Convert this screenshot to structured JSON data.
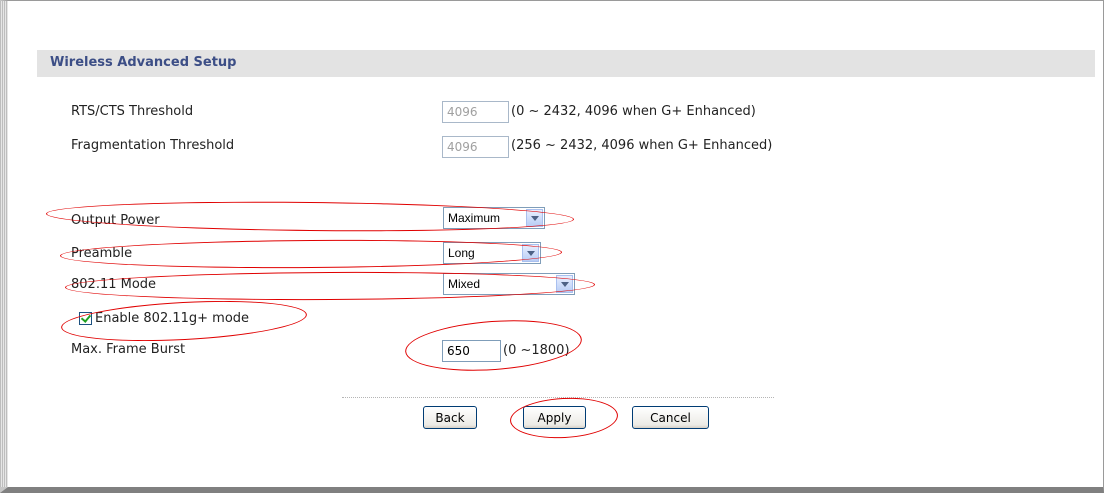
{
  "section": {
    "title": "Wireless Advanced Setup"
  },
  "rts": {
    "label": "RTS/CTS  Threshold",
    "value": "4096",
    "hint": "(0 ~ 2432, 4096 when G+ Enhanced)"
  },
  "frag": {
    "label": "Fragmentation  Threshold",
    "value": "4096",
    "hint": "(256 ~ 2432, 4096 when G+ Enhanced)"
  },
  "output_power": {
    "label": "Output Power",
    "selected": "Maximum"
  },
  "preamble": {
    "label": "Preamble",
    "selected": "Long"
  },
  "mode": {
    "label": "802.11 Mode",
    "selected": "Mixed"
  },
  "gplus": {
    "label": "Enable 802.11g+ mode",
    "checked": true
  },
  "frame_burst": {
    "label": "Max. Frame Burst",
    "value": "650",
    "hint": "(0 ~1800)"
  },
  "buttons": {
    "back": "Back",
    "apply": "Apply",
    "cancel": "Cancel"
  },
  "colors": {
    "title": "#3c4e86",
    "annotation": "#e00000"
  }
}
